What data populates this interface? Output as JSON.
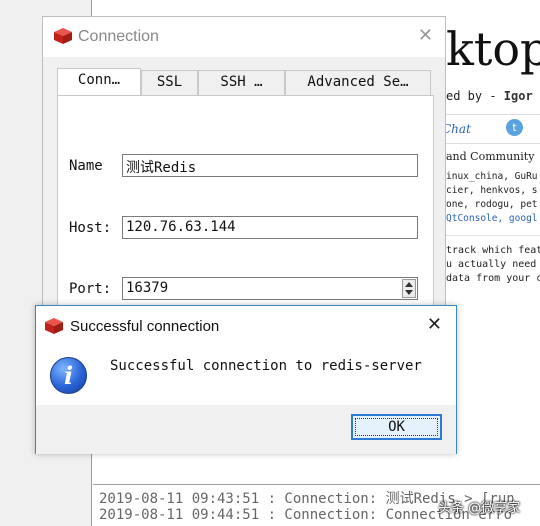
{
  "background": {
    "title_partial": "ktop",
    "credit_prefix": "ed by - ",
    "credit_name": "Igor M",
    "chat_link": "Chat",
    "community_heading": "and Community",
    "community_lines": [
      "inux_china, GuRu",
      "cier, henkvos, s",
      "one, rodogu, pet"
    ],
    "community_link_line": "QtConsole, googl",
    "track_lines": [
      "track which feat",
      "u actually need",
      "data from your c"
    ],
    "log_lines": [
      "2019-08-11 09:43:51 : Connection: 测试Redis > [run",
      "2019-08-11 09:44:51 : Connection: Connection erro"
    ]
  },
  "connection_dialog": {
    "title": "Connection",
    "tabs": [
      {
        "label": "Conn…"
      },
      {
        "label": "SSL"
      },
      {
        "label": "SSH …"
      },
      {
        "label": "Advanced Se…"
      }
    ],
    "fields": {
      "name_label": "Name",
      "name_value": "测试Redis",
      "host_label": "Host:",
      "host_value": "120.76.63.144",
      "port_label": "Port:",
      "port_value": "16379"
    }
  },
  "message_box": {
    "title": "Successful connection",
    "message": "Successful connection to redis-server",
    "ok_label": "OK"
  },
  "watermark": "头条 @微享家",
  "colors": {
    "redis_red": "#d9281e",
    "accent_blue": "#2c7ad6",
    "dialog_bg": "#f0f0f0"
  }
}
